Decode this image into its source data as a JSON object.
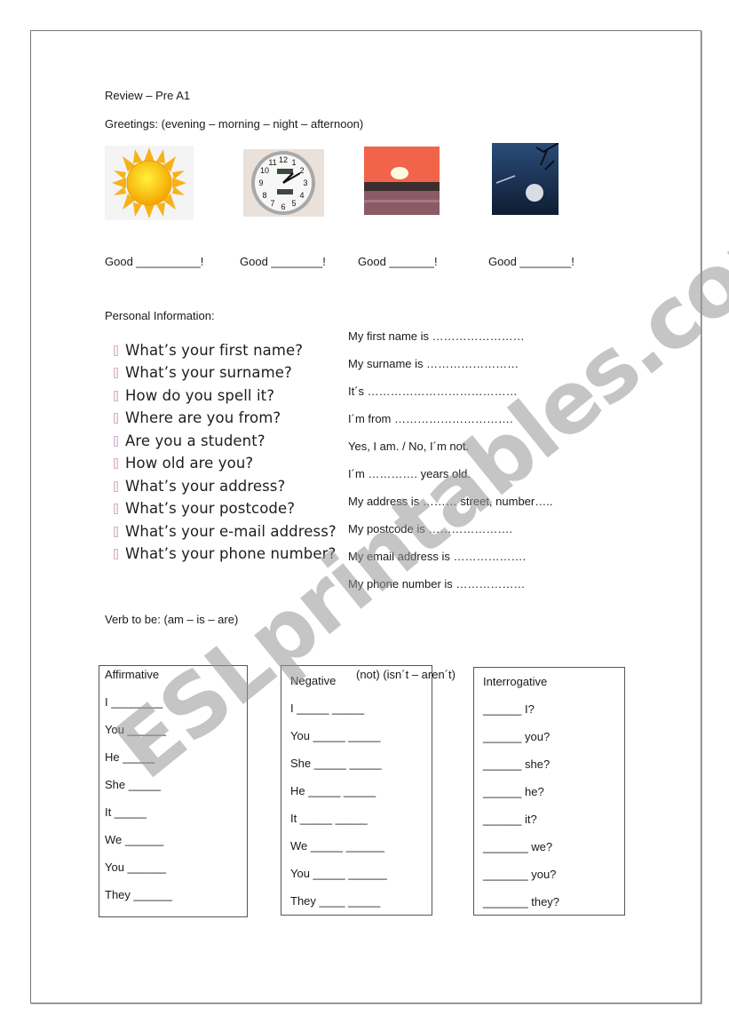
{
  "title": "Review – Pre A1",
  "greetings": {
    "heading": "Greetings: (evening – morning – night – afternoon)",
    "images": [
      {
        "icon": "sun-icon",
        "depicts": "sun"
      },
      {
        "icon": "clock-icon",
        "depicts": "clock"
      },
      {
        "icon": "sunset-icon",
        "depicts": "sunset"
      },
      {
        "icon": "moon-night-icon",
        "depicts": "moon at night"
      }
    ],
    "blanks": [
      "Good __________!",
      "Good ________!",
      "Good _______!",
      "Good ________!"
    ]
  },
  "personal": {
    "heading": "Personal Information:",
    "questions": [
      "What’s your first name?",
      "What’s your surname?",
      "How do you spell it?",
      "Where are you from?",
      "Are you a student?",
      "How old are you?",
      "What’s your address?",
      "What’s your postcode?",
      "What’s your e-mail address?",
      "What’s your phone number?"
    ],
    "answers": [
      "My first name is ……………………",
      "My surname is ……………………",
      "It´s …………………………………",
      "I´m from ………………………….",
      "Yes, I am. / No, I´m not.",
      "I´m …………. years old.",
      "My address is ……… street, number…..",
      "My postcode is ………………….",
      "My email address is ……………….",
      "My phone number is ………………"
    ]
  },
  "verb": {
    "heading": "Verb to be: (am – is – are)",
    "negative_note": "(not) (isn´t – aren´t)",
    "affirmative": {
      "title": "Affirmative",
      "rows": [
        "I ________",
        "You ______",
        "He _____",
        "She _____",
        "It _____",
        "We ______",
        "You ______",
        "They ______"
      ]
    },
    "negative": {
      "title": "Negative",
      "rows": [
        "I _____ _____",
        "You _____ _____",
        "She _____ _____",
        "He _____ _____",
        "It _____ _____",
        "We _____ ______",
        "You _____ ______",
        "They ____ _____"
      ]
    },
    "interrogative": {
      "title": "Interrogative",
      "rows": [
        "______ I?",
        "______ you?",
        "______ she?",
        "______ he?",
        "______ it?",
        "_______ we?",
        "_______ you?",
        "_______ they?"
      ]
    }
  },
  "watermark": "ESLprintables.com"
}
